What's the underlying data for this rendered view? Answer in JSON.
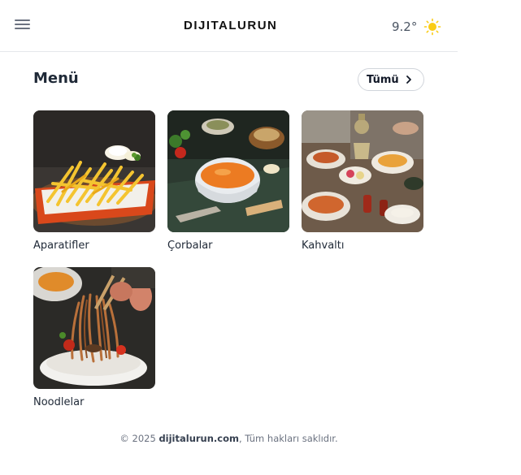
{
  "header": {
    "logo_text": "DIJITALURUN",
    "temperature": "9.2°",
    "weather_icon": "sun-icon",
    "menu_icon": "hamburger-menu-icon"
  },
  "section": {
    "title": "Menü",
    "all_button_label": "Tümü"
  },
  "categories": [
    {
      "label": "Aparatifler",
      "image": "french-fries-photo"
    },
    {
      "label": "Çorbalar",
      "image": "soup-bowl-photo"
    },
    {
      "label": "Kahvaltı",
      "image": "breakfast-spread-photo"
    },
    {
      "label": "Noodlelar",
      "image": "noodles-chopsticks-photo"
    }
  ],
  "footer": {
    "prefix": "© 2025 ",
    "site": "dijitalurun.com",
    "suffix": ", Tüm hakları saklıdır."
  },
  "colors": {
    "accent_sun": "#facc15",
    "text_dark": "#1f2937",
    "text_muted": "#6b7280"
  }
}
